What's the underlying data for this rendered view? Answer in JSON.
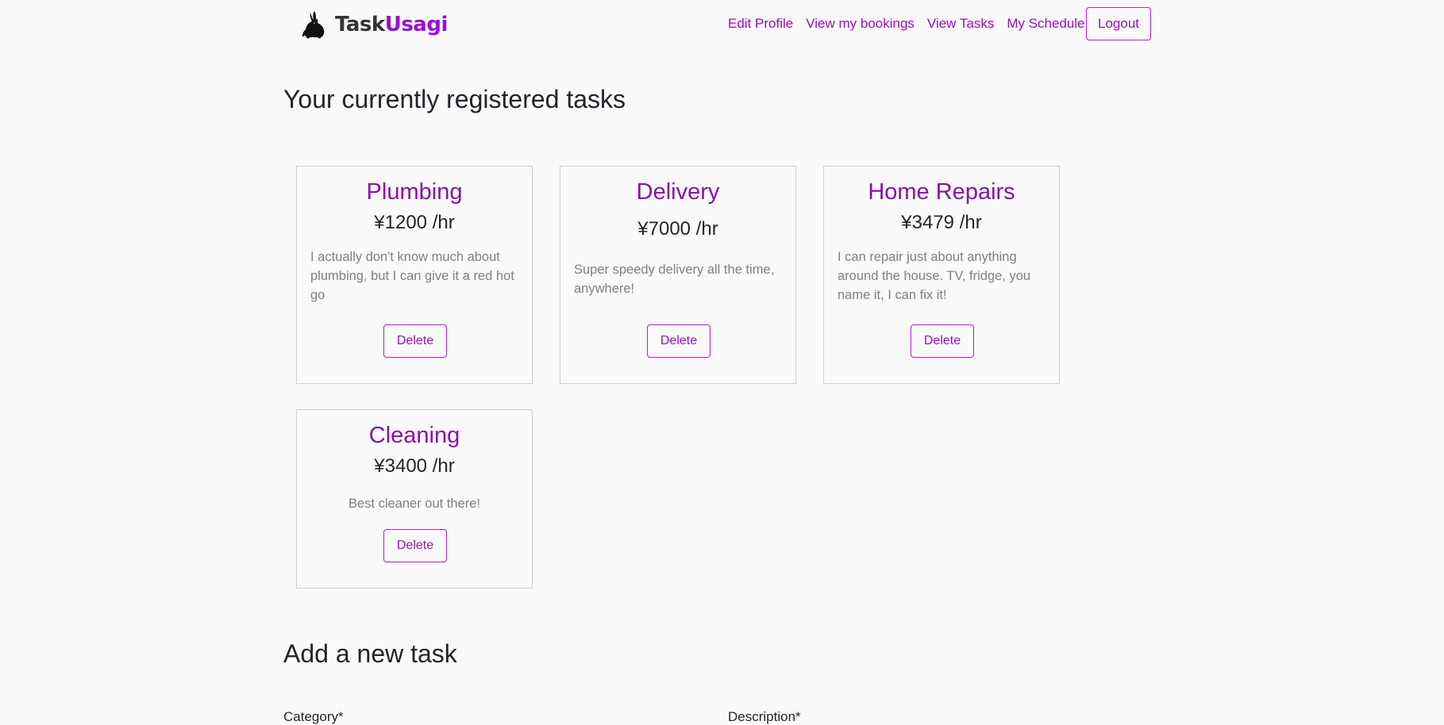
{
  "brand": {
    "task": "Task",
    "usagi": "Usagi",
    "logo_icon": "rabbit-icon"
  },
  "nav": {
    "links": [
      "Edit Profile",
      "View my bookings",
      "View Tasks",
      "My Schedule"
    ],
    "logout": "Logout"
  },
  "main": {
    "registered_title": "Your currently registered tasks",
    "tasks": [
      {
        "title": "Plumbing",
        "price": "¥1200 /hr",
        "description": "I actually don't know much about plumbing, but I can give it a red hot go",
        "delete": "Delete"
      },
      {
        "title": "Delivery",
        "price": "¥7000 /hr",
        "description": "Super speedy delivery all the time, anywhere!",
        "delete": "Delete"
      },
      {
        "title": "Home Repairs",
        "price": "¥3479 /hr",
        "description": "I can repair just about anything around the house. TV, fridge, you name it, I can fix it!",
        "delete": "Delete"
      },
      {
        "title": "Cleaning",
        "price": "¥3400 /hr",
        "description": "Best cleaner out there!",
        "delete": "Delete"
      }
    ],
    "add_title": "Add a new task",
    "form": {
      "category_label": "Category*",
      "description_label": "Description*"
    }
  },
  "colors": {
    "accent": "#9b0fbf",
    "background": "#fafafa"
  }
}
